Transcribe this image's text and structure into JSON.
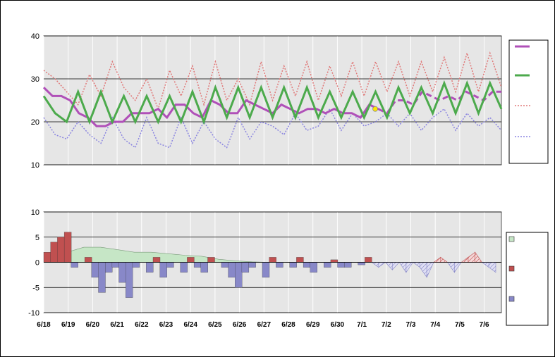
{
  "colors": {
    "plot_bg": "#e6e6e6",
    "forecast_temp": "#b050b8",
    "observed_temp": "#4caa4c",
    "normal_high": "#e07878",
    "normal_low": "#8a84e0",
    "diff_cumulative": "#c6e6c6",
    "diff_positive": "#c05050",
    "diff_negative": "#8888c8",
    "marker": "#ffe600"
  },
  "chart_data": [
    {
      "type": "line",
      "x_dates": [
        "6/18",
        "6/19",
        "6/20",
        "6/21",
        "6/22",
        "6/23",
        "6/24",
        "6/25",
        "6/26",
        "6/27",
        "6/28",
        "6/29",
        "6/30",
        "7/1",
        "7/2",
        "7/3",
        "7/4",
        "7/5",
        "7/6"
      ],
      "ylim": [
        10,
        40
      ],
      "yticks": [
        10,
        20,
        30,
        40
      ],
      "grid": true,
      "legend": "right",
      "series": [
        {
          "key": "forecast",
          "style": "solid thick magenta, dashed after 7/1",
          "values": [
            28,
            26,
            26,
            25,
            22,
            21,
            19,
            19,
            20,
            20,
            22,
            22,
            22,
            23,
            21,
            24,
            24,
            22,
            21,
            25,
            24,
            22,
            22,
            25,
            24,
            23,
            22,
            24,
            23,
            22,
            23,
            23,
            22,
            23,
            22,
            22,
            21,
            24,
            23,
            22,
            25,
            25,
            24,
            27,
            26,
            25,
            26,
            25,
            27,
            26,
            25,
            27,
            27
          ]
        },
        {
          "key": "observed",
          "style": "solid green, daily cycle",
          "values": [
            26,
            22,
            20,
            27,
            20,
            27,
            20,
            26,
            20,
            26,
            20,
            26,
            20,
            27,
            20,
            28,
            21,
            28,
            21,
            28,
            21,
            28,
            21,
            28,
            21,
            27,
            21,
            27,
            21,
            27,
            21,
            28,
            22,
            28,
            22,
            29,
            22,
            29,
            22,
            29,
            23
          ]
        },
        {
          "key": "normal_high",
          "style": "dotted red",
          "values": [
            32,
            30,
            27,
            24,
            31,
            26,
            34,
            28,
            25,
            30,
            23,
            32,
            26,
            33,
            24,
            34,
            25,
            30,
            24,
            34,
            25,
            33,
            26,
            34,
            25,
            33,
            26,
            34,
            26,
            34,
            27,
            34,
            26,
            34,
            27,
            35,
            27,
            36,
            27,
            36,
            28
          ]
        },
        {
          "key": "normal_low",
          "style": "dotted blue",
          "values": [
            21,
            17,
            16,
            20,
            17,
            15,
            21,
            16,
            14,
            21,
            15,
            14,
            21,
            15,
            20,
            16,
            14,
            21,
            16,
            20,
            19,
            17,
            22,
            18,
            19,
            23,
            18,
            22,
            19,
            20,
            22,
            19,
            22,
            18,
            21,
            23,
            18,
            22,
            19,
            21,
            18
          ]
        }
      ],
      "marker": {
        "x_date": "7/1",
        "y": 23
      }
    },
    {
      "type": "area",
      "x_dates": [
        "6/18",
        "6/19",
        "6/20",
        "6/21",
        "6/22",
        "6/23",
        "6/24",
        "6/25",
        "6/26",
        "6/27",
        "6/28",
        "6/29",
        "6/30",
        "7/1",
        "7/2",
        "7/3",
        "7/4",
        "7/5",
        "7/6"
      ],
      "ylim": [
        -10,
        10
      ],
      "yticks": [
        -10,
        -5,
        0,
        5,
        10
      ],
      "grid": true,
      "legend": "right",
      "series": [
        {
          "key": "cumulative",
          "values": [
            2,
            3,
            3,
            2.5,
            2,
            2,
            1.7,
            1.4,
            1.2,
            0.6,
            0.3,
            0.1,
            0,
            0
          ]
        },
        {
          "key": "daily_diff_observed",
          "values": [
            2,
            4,
            5,
            6,
            -1,
            0,
            1,
            -3,
            -6,
            -2,
            -1,
            -4,
            -7,
            -1,
            0,
            -2,
            1,
            -3,
            -1,
            0,
            -2,
            1,
            -1,
            -2,
            1,
            0,
            -1,
            -3,
            -5,
            -2,
            -1,
            0,
            -3,
            1,
            -1,
            0,
            -1,
            1,
            -1,
            -2,
            0,
            -1,
            0.5,
            -1,
            -1,
            0,
            -0.5,
            1
          ]
        },
        {
          "key": "daily_diff_forecast",
          "values": [
            0,
            -1,
            0,
            -1.5,
            0,
            -2,
            0,
            -1,
            -3,
            0,
            1,
            0,
            -2,
            0,
            1,
            2,
            0,
            -1,
            -2
          ]
        }
      ]
    }
  ]
}
